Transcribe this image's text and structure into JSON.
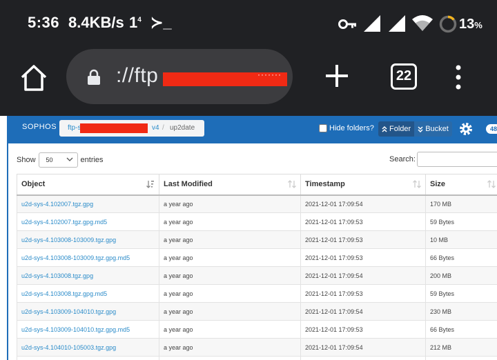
{
  "status_bar": {
    "time": "5:36",
    "net_speed": "8.4KB/s",
    "notification": "1",
    "notification_sup": "4",
    "terminal": "≻_",
    "battery_percent": "13",
    "battery_unit": "%",
    "icons": [
      "key-icon",
      "cell-signal-icon",
      "cell-signal-icon",
      "wifi-icon",
      "battery-ring-icon"
    ]
  },
  "browser": {
    "url": "://ftp",
    "url_redacted_tail": "·······",
    "tab_count": "22",
    "icons": [
      "home-icon",
      "lock-icon",
      "plus-icon",
      "more-vert-icon"
    ]
  },
  "nav": {
    "brand": "SOPHOS",
    "breadcrumb": [
      "ftp-s",
      "v4",
      "/",
      "up2date"
    ],
    "hide_folders_label": "Hide folders?",
    "hide_folders_checked": false,
    "folder_btn": "Folder",
    "bucket_btn": "Bucket",
    "badge": "48",
    "accent_color": "#1e6db8"
  },
  "controls": {
    "show_label": "Show",
    "entries_value": "50",
    "entries_label": "entries",
    "search_label": "Search:",
    "search_value": ""
  },
  "table": {
    "columns": [
      "Object",
      "Last Modified",
      "Timestamp",
      "Size"
    ],
    "rows": [
      {
        "object": "u2d-sys-4.102007.tgz.gpg",
        "modified": "a year ago",
        "timestamp": "2021-12-01 17:09:54",
        "size": "170 MB"
      },
      {
        "object": "u2d-sys-4.102007.tgz.gpg.md5",
        "modified": "a year ago",
        "timestamp": "2021-12-01 17:09:53",
        "size": "59 Bytes"
      },
      {
        "object": "u2d-sys-4.103008-103009.tgz.gpg",
        "modified": "a year ago",
        "timestamp": "2021-12-01 17:09:53",
        "size": "10 MB"
      },
      {
        "object": "u2d-sys-4.103008-103009.tgz.gpg.md5",
        "modified": "a year ago",
        "timestamp": "2021-12-01 17:09:53",
        "size": "66 Bytes"
      },
      {
        "object": "u2d-sys-4.103008.tgz.gpg",
        "modified": "a year ago",
        "timestamp": "2021-12-01 17:09:54",
        "size": "200 MB"
      },
      {
        "object": "u2d-sys-4.103008.tgz.gpg.md5",
        "modified": "a year ago",
        "timestamp": "2021-12-01 17:09:53",
        "size": "59 Bytes"
      },
      {
        "object": "u2d-sys-4.103009-104010.tgz.gpg",
        "modified": "a year ago",
        "timestamp": "2021-12-01 17:09:54",
        "size": "230 MB"
      },
      {
        "object": "u2d-sys-4.103009-104010.tgz.gpg.md5",
        "modified": "a year ago",
        "timestamp": "2021-12-01 17:09:53",
        "size": "66 Bytes"
      },
      {
        "object": "u2d-sys-4.104010-105003.tgz.gpg",
        "modified": "a year ago",
        "timestamp": "2021-12-01 17:09:54",
        "size": "212 MB"
      },
      {
        "object": "",
        "modified": "",
        "timestamp": "",
        "size": ""
      }
    ]
  }
}
